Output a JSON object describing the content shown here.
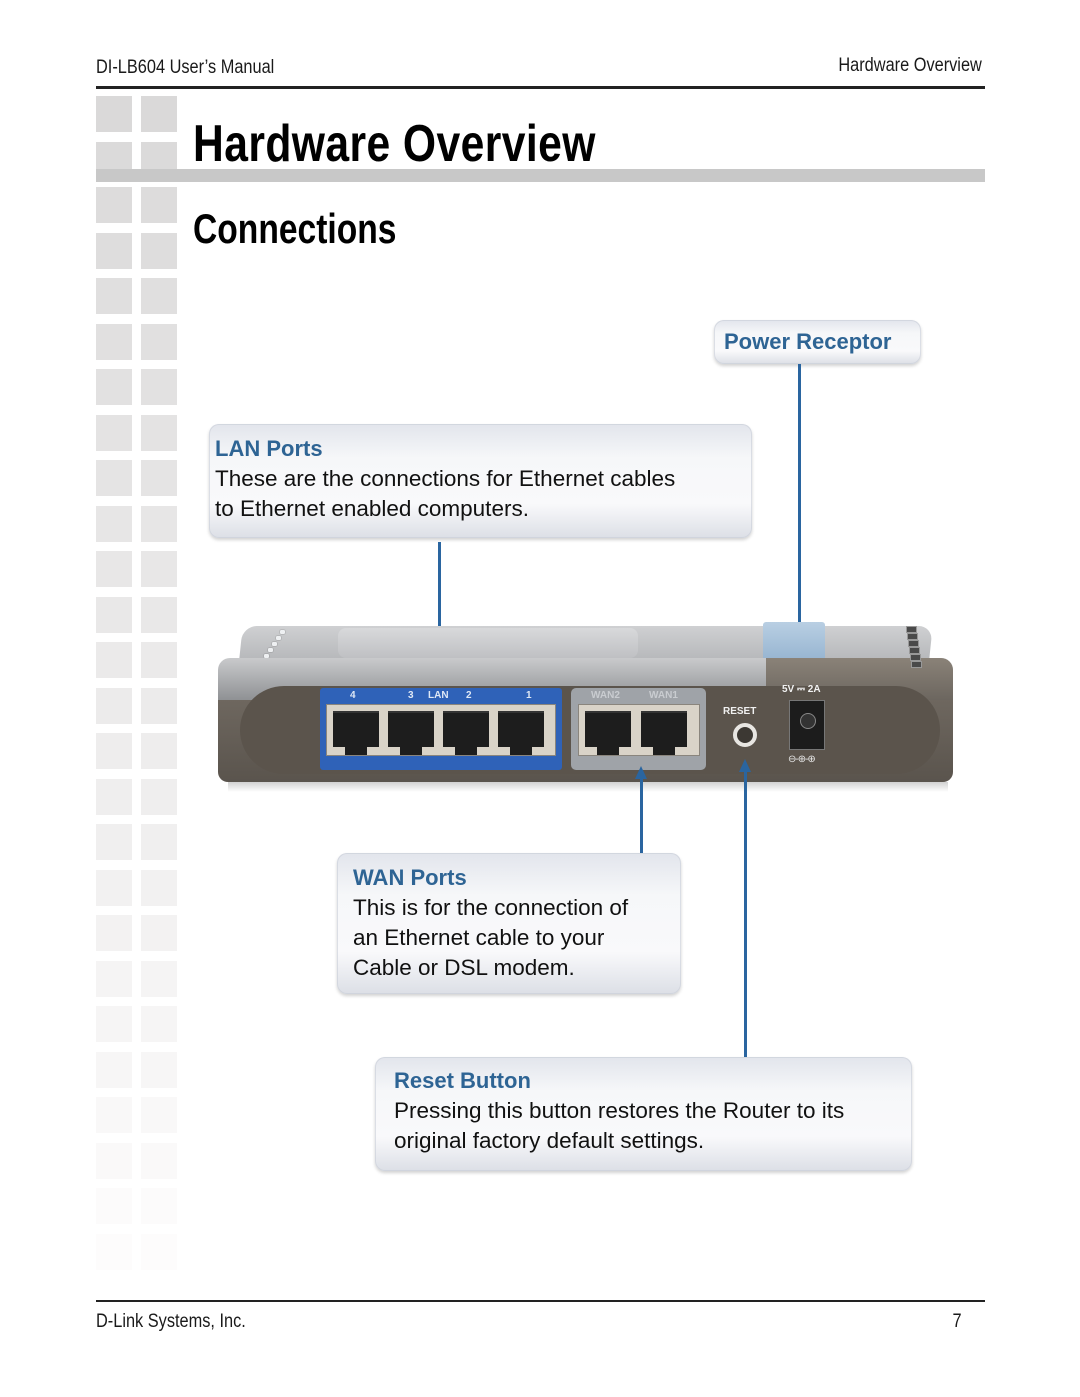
{
  "header": {
    "manual_title": "DI-LB604 User’s Manual",
    "section_name": "Hardware Overview"
  },
  "page": {
    "title": "Hardware Overview",
    "subtitle": "Connections"
  },
  "callouts": {
    "power_receptor": {
      "title": "Power Receptor"
    },
    "lan_ports": {
      "title": "LAN Ports",
      "body_lines": [
        "These are the connections for Ethernet cables",
        "to Ethernet enabled computers."
      ]
    },
    "wan_ports": {
      "title": "WAN Ports",
      "body_lines": [
        "This is for the connection of",
        "an Ethernet cable to your",
        "Cable or DSL modem."
      ]
    },
    "reset_button": {
      "title": "Reset Button",
      "body_lines": [
        "Pressing this button restores the Router to its",
        "original factory default settings."
      ]
    }
  },
  "router": {
    "lan_labels": [
      "4",
      "3",
      "LAN",
      "2",
      "1"
    ],
    "wan_labels": [
      "WAN2",
      "WAN1"
    ],
    "reset_label": "RESET",
    "power_label": "5V ⎓ 2A",
    "polarity_label": "⊖-⊕-⊕"
  },
  "colors": {
    "accent_blue": "#2e6494",
    "arrow_blue": "#2a65a0",
    "lan_block": "#2f62b8",
    "wan_block": "#9fa3a8"
  },
  "footer": {
    "company": "D-Link Systems, Inc.",
    "page_number": "7"
  }
}
